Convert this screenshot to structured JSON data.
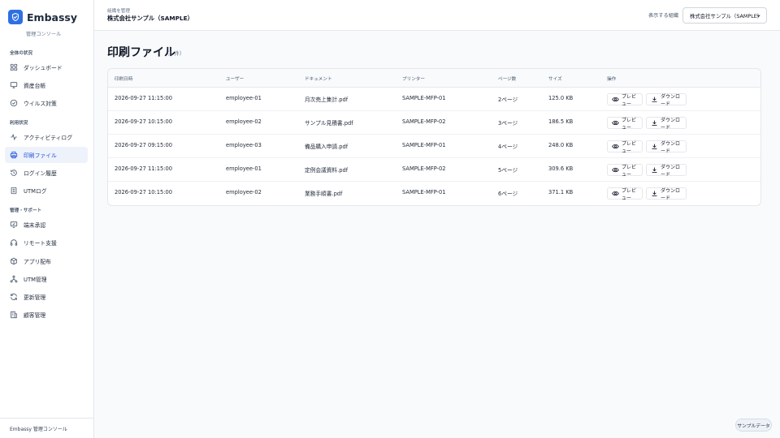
{
  "brand": {
    "name": "Embassy",
    "subtitle": "管理コンソール",
    "logo_icon": "shield-check-icon",
    "logo_color": "#2f6fe4"
  },
  "sidebar": {
    "sections": [
      {
        "label": "全体の状況",
        "items": [
          {
            "label": "ダッシュボード",
            "icon": "dashboard-icon"
          },
          {
            "label": "資産台帳",
            "icon": "monitor-icon"
          },
          {
            "label": "ウイルス対策",
            "icon": "shield-check-icon"
          }
        ]
      },
      {
        "label": "利用状況",
        "items": [
          {
            "label": "アクティビティログ",
            "icon": "activity-icon"
          },
          {
            "label": "印刷ファイル",
            "icon": "printer-icon",
            "active": true
          },
          {
            "label": "ログイン履歴",
            "icon": "history-icon"
          },
          {
            "label": "UTMログ",
            "icon": "document-list-icon"
          }
        ]
      },
      {
        "label": "管理・サポート",
        "items": [
          {
            "label": "端末承認",
            "icon": "device-check-icon"
          },
          {
            "label": "リモート支援",
            "icon": "headset-icon"
          },
          {
            "label": "アプリ配布",
            "icon": "package-icon"
          },
          {
            "label": "UTM管理",
            "icon": "network-icon"
          },
          {
            "label": "更新管理",
            "icon": "refresh-icon"
          },
          {
            "label": "顧客管理",
            "icon": "building-icon"
          }
        ]
      }
    ],
    "footer": "Embassy 管理コンソール"
  },
  "header": {
    "org_label": "組織を管理",
    "org_name": "株式会社サンプル（SAMPLE）",
    "view_label": "表示する組織",
    "org_select_value": "株式会社サンプル（SAMPLE）"
  },
  "main": {
    "title": "印刷ファイル",
    "count": "（5 件）",
    "columns": [
      "印刷日時",
      "ユーザー",
      "ドキュメント",
      "プリンター",
      "ページ数",
      "サイズ",
      "操作"
    ],
    "rows": [
      {
        "date": "2026-09-27 11:15:00",
        "user": "employee-01",
        "document": "月次売上集計.pdf",
        "printer": "SAMPLE-MFP-01",
        "pages": "2ページ",
        "size": "125.0 KB"
      },
      {
        "date": "2026-09-27 10:15:00",
        "user": "employee-02",
        "document": "サンプル見積書.pdf",
        "printer": "SAMPLE-MFP-02",
        "pages": "3ページ",
        "size": "186.5 KB"
      },
      {
        "date": "2026-09-27 09:15:00",
        "user": "employee-03",
        "document": "備品購入申請.pdf",
        "printer": "SAMPLE-MFP-01",
        "pages": "4ページ",
        "size": "248.0 KB"
      },
      {
        "date": "2026-09-27 11:15:00",
        "user": "employee-01",
        "document": "定例会議資料.pdf",
        "printer": "SAMPLE-MFP-02",
        "pages": "5ページ",
        "size": "309.6 KB"
      },
      {
        "date": "2026-09-27 10:15:00",
        "user": "employee-02",
        "document": "業務手順書.pdf",
        "printer": "SAMPLE-MFP-01",
        "pages": "6ページ",
        "size": "371.1 KB"
      }
    ],
    "actions": {
      "preview": "プレビュー",
      "download": "ダウンロード"
    }
  },
  "badge": "サンプルデータ"
}
